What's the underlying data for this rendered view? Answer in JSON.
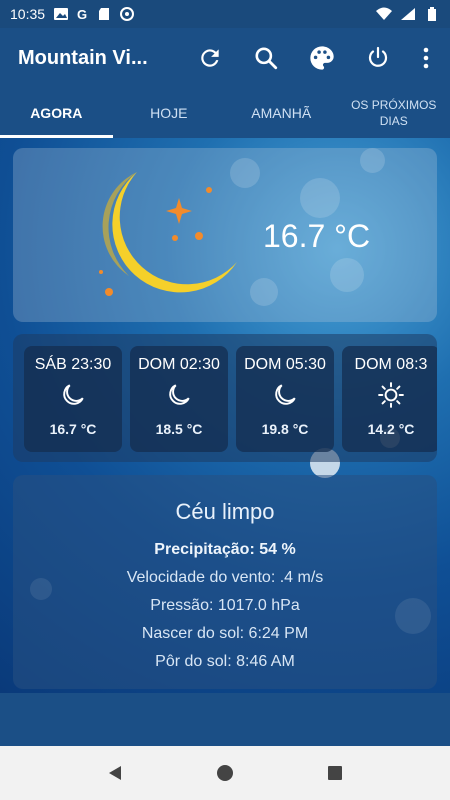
{
  "status_bar": {
    "time": "10:35",
    "notif_icons": [
      "gallery-icon",
      "google-icon",
      "sd-card-icon",
      "at-sign-icon"
    ],
    "right_icons": [
      "wifi-icon",
      "signal-icon",
      "battery-icon"
    ]
  },
  "app_bar": {
    "title": "Mountain Vi...",
    "actions": [
      "refresh-icon",
      "search-icon",
      "palette-icon",
      "power-icon",
      "more-vert-icon"
    ]
  },
  "tabs": [
    {
      "label": "AGORA",
      "active": true
    },
    {
      "label": "HOJE",
      "active": false
    },
    {
      "label": "AMANHÃ",
      "active": false
    },
    {
      "label": "OS PRÓXIMOS DIAS",
      "active": false
    }
  ],
  "current": {
    "icon": "moon-icon",
    "temperature": "16.7 °C"
  },
  "hourly": [
    {
      "time": "SÁB 23:30",
      "icon": "moon-icon",
      "temp": "16.7 °C"
    },
    {
      "time": "DOM 02:30",
      "icon": "moon-icon",
      "temp": "18.5 °C"
    },
    {
      "time": "DOM 05:30",
      "icon": "moon-icon",
      "temp": "19.8 °C"
    },
    {
      "time": "DOM 08:3",
      "icon": "sun-icon",
      "temp": "14.2 °C"
    }
  ],
  "details": {
    "title": "Céu limpo",
    "precipitation": "Precipitação: 54 %",
    "wind": "Velocidade do vento: .4 m/s",
    "pressure": "Pressão: 1017.0 hPa",
    "sunrise": "Nascer do sol: 6:24 PM",
    "sunset": "Pôr do sol: 8:46 AM"
  },
  "colors": {
    "primary": "#1b4f86",
    "moon": "#f5d02a",
    "star": "#f28b2b"
  },
  "nav_bar": [
    "back-icon",
    "home-icon",
    "recents-icon"
  ]
}
